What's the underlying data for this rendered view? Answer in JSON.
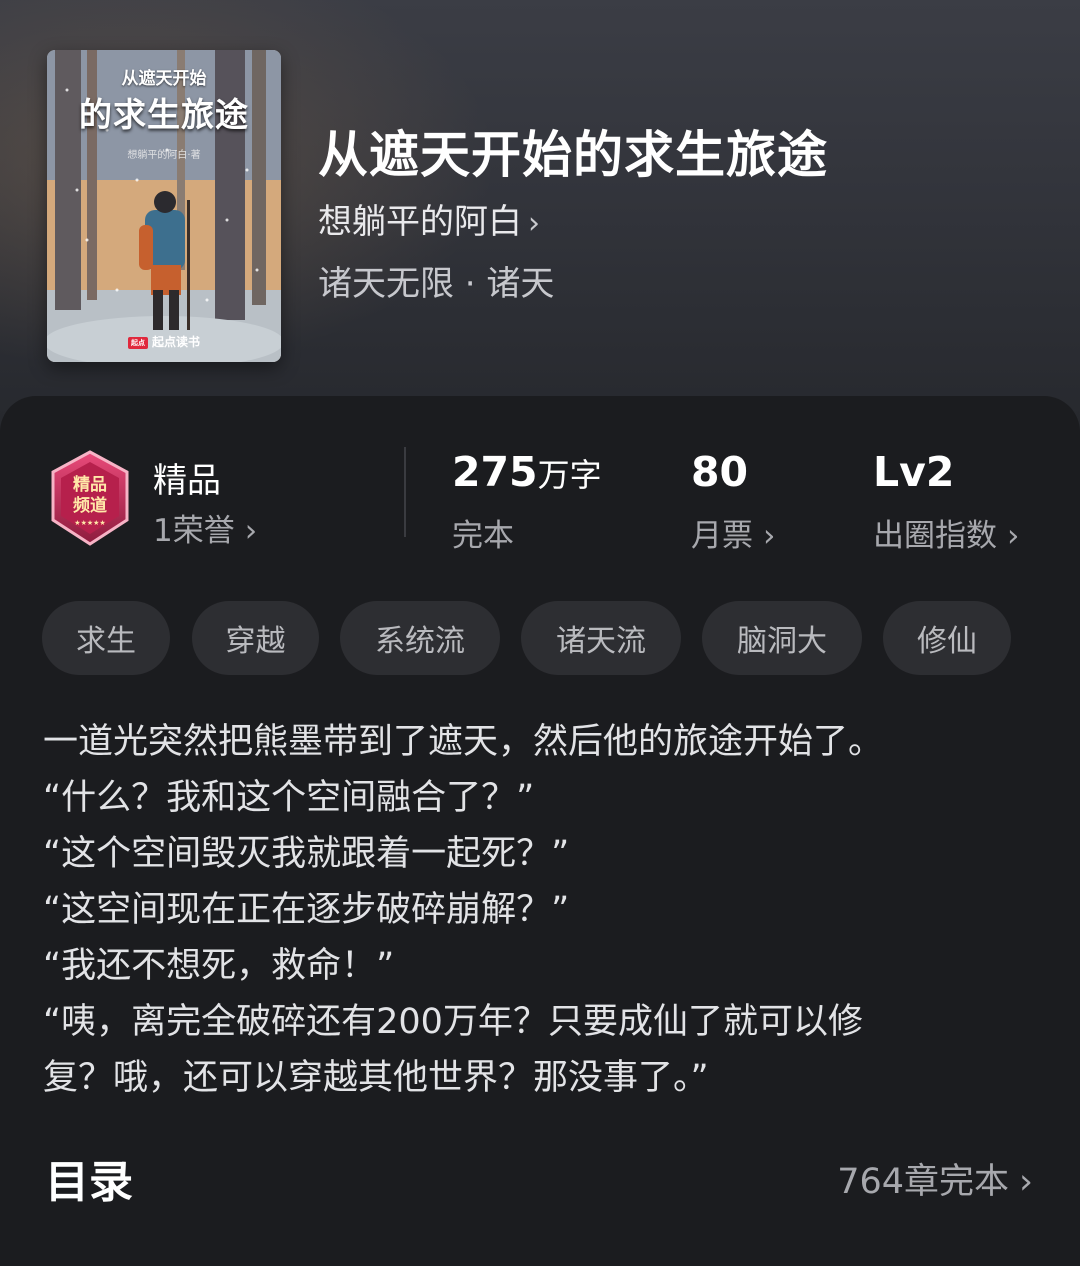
{
  "book": {
    "title": "从遮天开始的求生旅途",
    "author": "想躺平的阿白",
    "genre": "诸天无限 · 诸天",
    "cover": {
      "title_small": "从遮天开始",
      "title_big": "的求生旅途",
      "author": "想躺平的阿白·著",
      "brand_mark": "起点",
      "brand": "起点读书"
    }
  },
  "stats": {
    "honor": {
      "label": "精品",
      "sub": "1荣誉",
      "badge_text": "精品频道"
    },
    "words": {
      "number": "275",
      "unit": "万字",
      "sub": "完本"
    },
    "votes": {
      "number": "80",
      "sub": "月票"
    },
    "index": {
      "number": "Lv2",
      "sub": "出圈指数"
    }
  },
  "tags": [
    "求生",
    "穿越",
    "系统流",
    "诸天流",
    "脑洞大",
    "修仙"
  ],
  "synopsis": [
    "一道光突然把熊墨带到了遮天，然后他的旅途开始了。",
    "“什么？我和这个空间融合了？”",
    "“这个空间毁灭我就跟着一起死？”",
    "“这空间现在正在逐步破碎崩解？”",
    "“我还不想死，救命！”",
    "“咦，离完全破碎还有200万年？只要成仙了就可以修",
    "复？哦，还可以穿越其他世界？那没事了。”"
  ],
  "toc": {
    "title": "目录",
    "count": "764章完本"
  },
  "icons": {
    "chevron": "chevron-right-icon",
    "badge": "quality-badge-icon"
  },
  "colors": {
    "panel": "#1b1c1f",
    "tag_bg": "#2d2e32",
    "badge": "#c1265a"
  }
}
